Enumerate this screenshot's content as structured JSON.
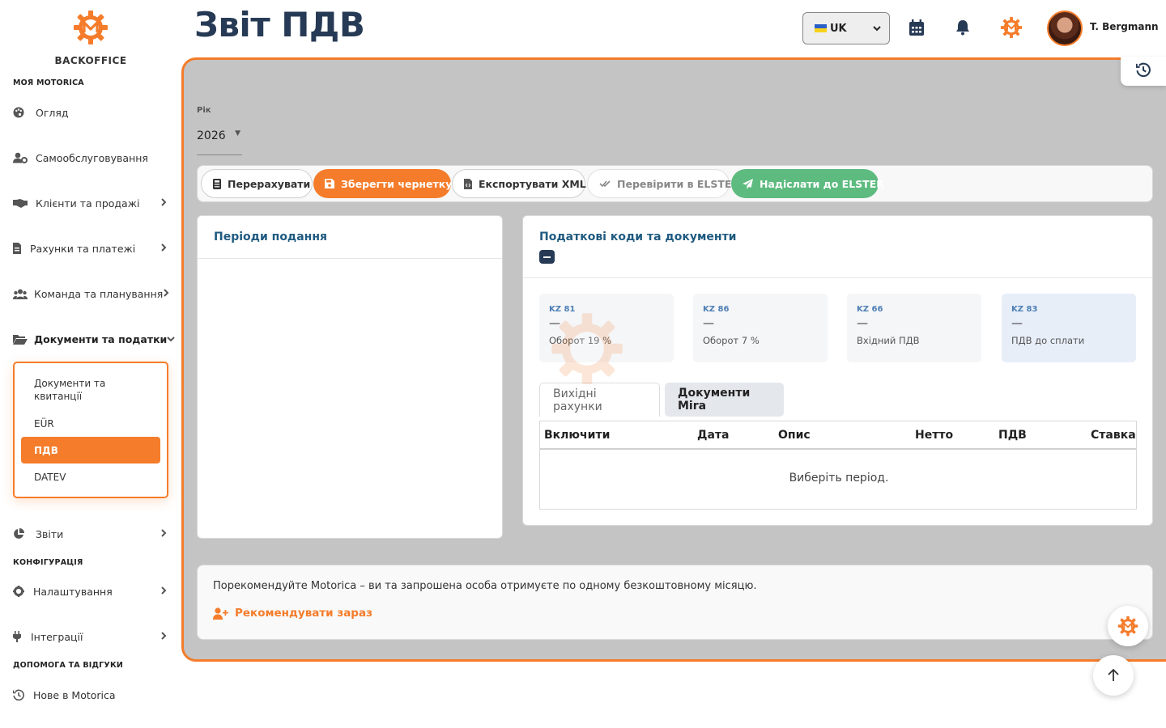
{
  "brand": {
    "name": "BACKOFFICE",
    "accent": "#f47c2a",
    "navy": "#263a55"
  },
  "header": {
    "title": "Звіт ПДВ",
    "language": "UK",
    "user_name": "T. Bergmann"
  },
  "sidebar": {
    "sections": {
      "my": "МОЯ MOTORICA",
      "config": "КОНФІГУРАЦІЯ",
      "help": "ДОПОМОГА ТА ВІДГУКИ"
    },
    "items": [
      {
        "label": "Огляд",
        "icon": "palette-icon"
      },
      {
        "label": "Самообслуговування",
        "icon": "user-gear-icon"
      },
      {
        "label": "Клієнти та продажі",
        "icon": "handshake-icon"
      },
      {
        "label": "Рахунки та платежі",
        "icon": "invoice-icon"
      },
      {
        "label": "Команда та планування",
        "icon": "users-icon"
      },
      {
        "label": "Документи та податки",
        "icon": "folder-open-icon"
      },
      {
        "label": "Звіти",
        "icon": "pie-chart-icon"
      },
      {
        "label": "Налаштування",
        "icon": "gear-icon"
      },
      {
        "label": "Інтеграції",
        "icon": "plug-icon"
      },
      {
        "label": "Нове в Motorica",
        "icon": "history-icon"
      }
    ],
    "submenu": [
      {
        "label": "Документи та квитанції"
      },
      {
        "label": "EÜR"
      },
      {
        "label": "ПДВ"
      },
      {
        "label": "DATEV"
      }
    ]
  },
  "filters": {
    "year_label": "Рік",
    "year_value": "2026"
  },
  "toolbar": {
    "recalc": "Перерахувати",
    "save_draft": "Зберегти чернетку",
    "export_xml": "Експортувати XML",
    "check_elster": "Перевірити в ELSTER",
    "send_elster": "Надіслати до ELSTER"
  },
  "periods": {
    "title": "Періоди подання"
  },
  "codes": {
    "title": "Податкові коди та документи",
    "boxes": [
      {
        "code": "KZ 81",
        "value": "—",
        "desc": "Оборот 19 %"
      },
      {
        "code": "KZ 86",
        "value": "—",
        "desc": "Оборот 7 %"
      },
      {
        "code": "KZ 66",
        "value": "—",
        "desc": "Вхідний ПДВ"
      },
      {
        "code": "KZ 83",
        "value": "—",
        "desc": "ПДВ до сплати"
      }
    ],
    "tabs": {
      "outgoing": "Вихідні рахунки",
      "mira": "Документи Mira"
    },
    "table": {
      "columns": [
        "Включити",
        "Дата",
        "Опис",
        "Нетто",
        "ПДВ",
        "Ставка"
      ],
      "empty": "Виберіть період."
    }
  },
  "referral": {
    "text": "Порекомендуйте Motorica – ви та запрошена особа отримуєте по одному безкоштовному місяцю.",
    "link": "Рекомендувати зараз"
  }
}
